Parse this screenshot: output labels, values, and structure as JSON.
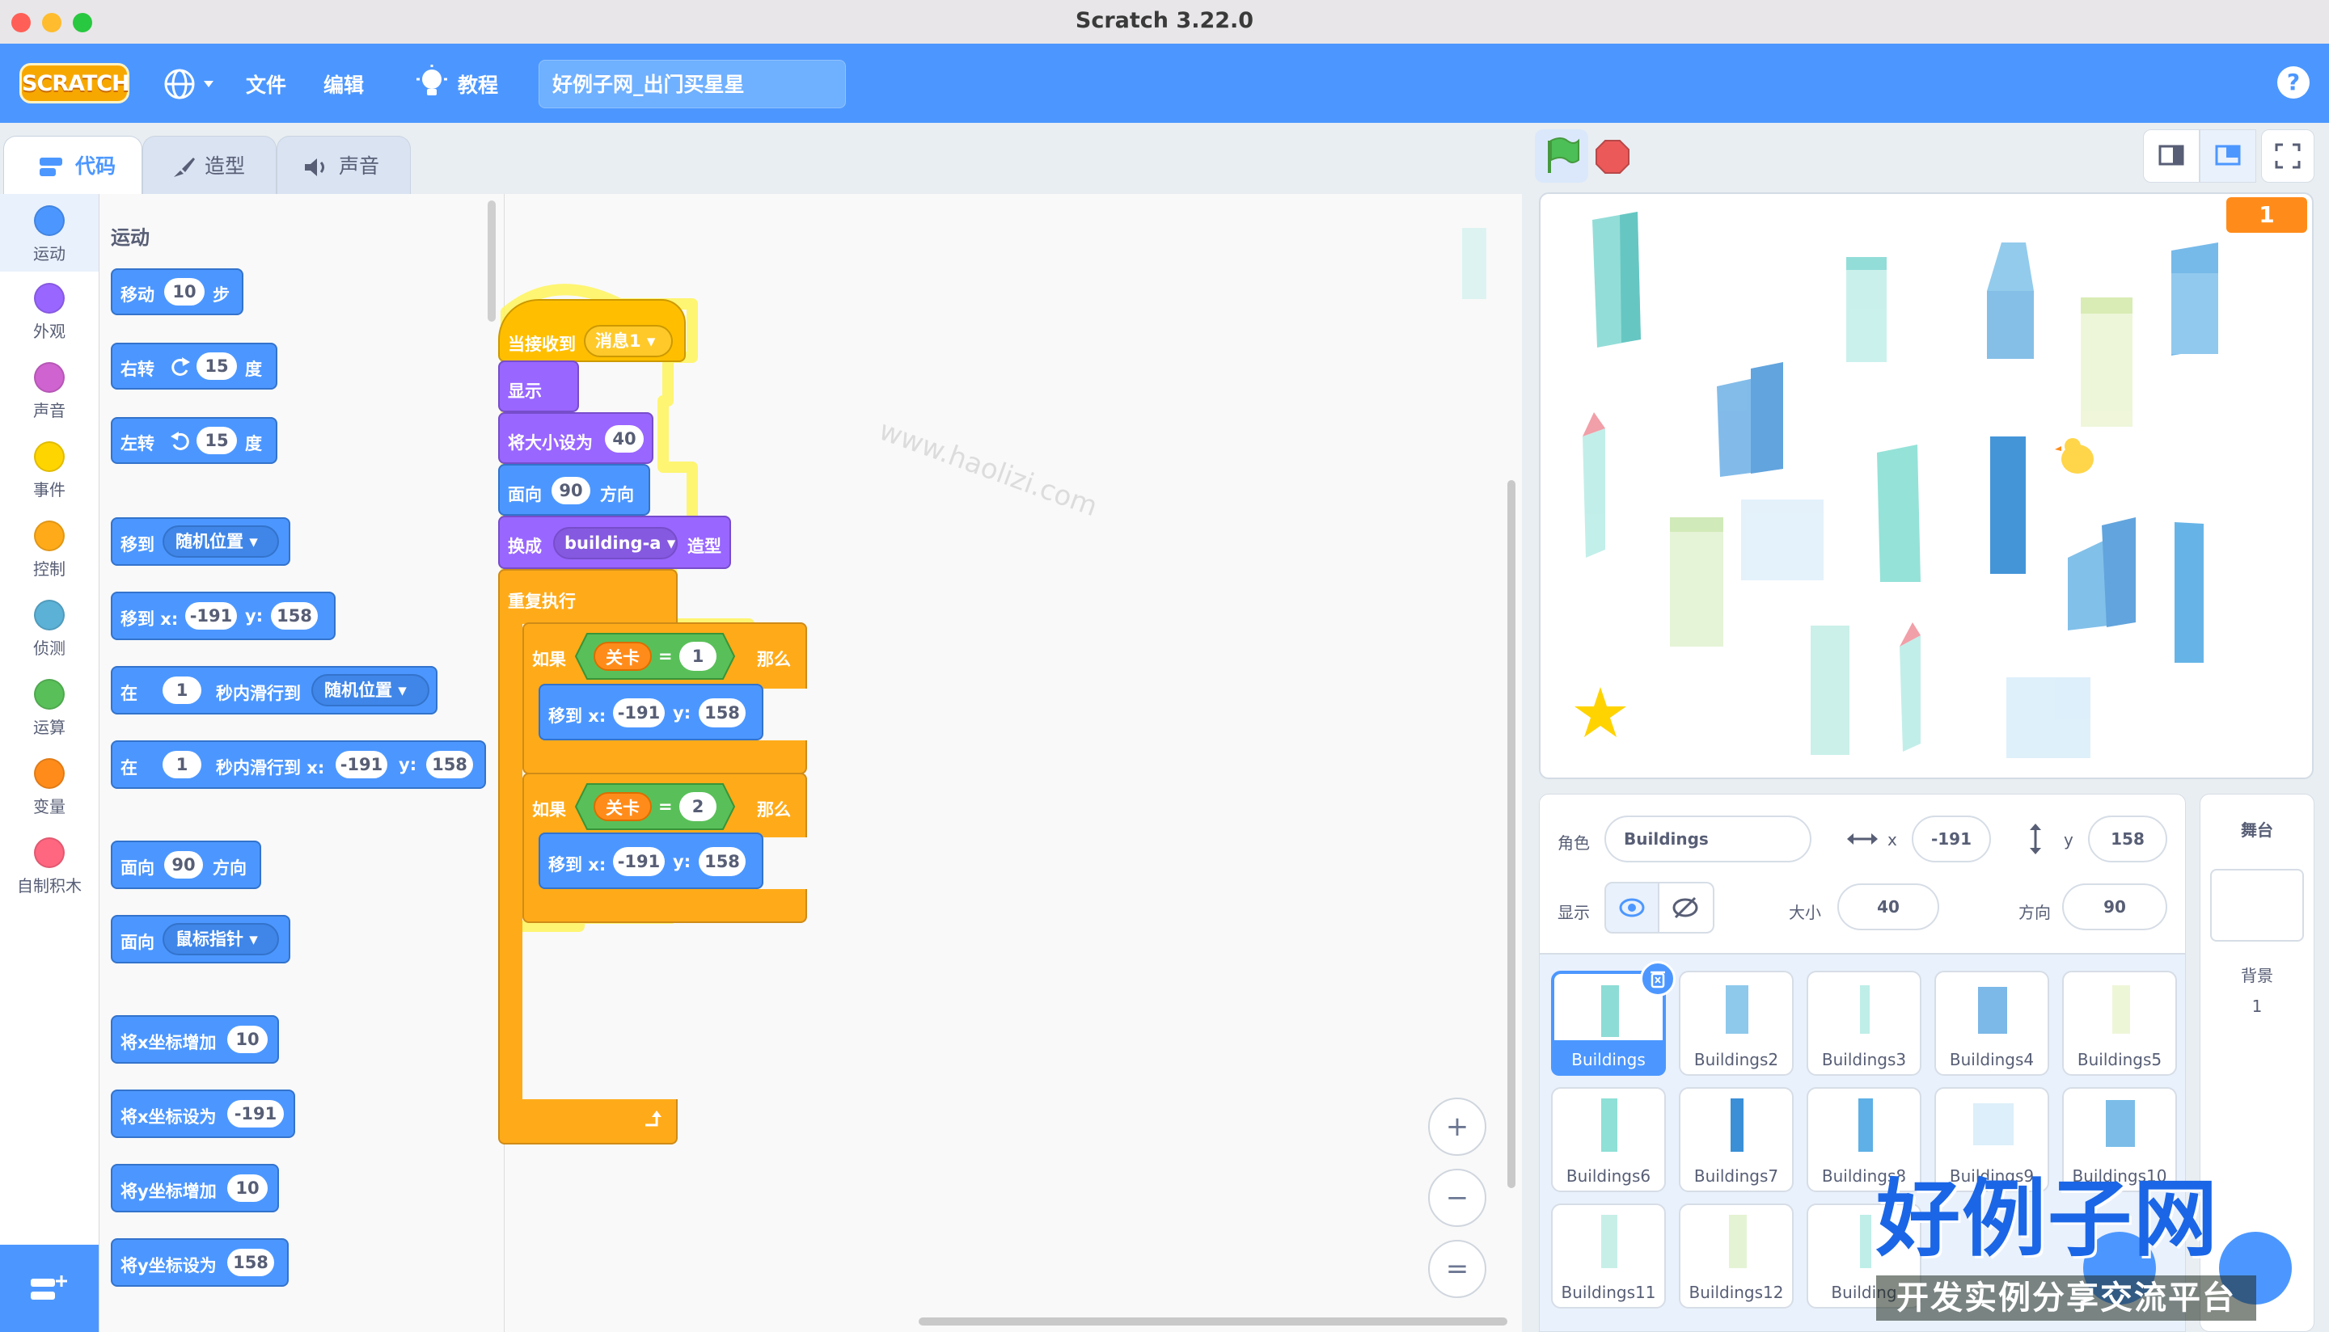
{
  "window": {
    "title": "Scratch 3.22.0"
  },
  "menubar": {
    "logo": "SCRATCH",
    "file": "文件",
    "edit": "编辑",
    "tutorials": "教程",
    "project_title": "好例子网_出门买星星",
    "help": "?"
  },
  "tabs": {
    "code": "代码",
    "costumes": "造型",
    "sounds": "声音"
  },
  "categories": [
    {
      "label": "运动",
      "color": "#4c97ff"
    },
    {
      "label": "外观",
      "color": "#9966ff"
    },
    {
      "label": "声音",
      "color": "#cf63cf"
    },
    {
      "label": "事件",
      "color": "#ffd500"
    },
    {
      "label": "控制",
      "color": "#ffab19"
    },
    {
      "label": "侦测",
      "color": "#5cb1d6"
    },
    {
      "label": "运算",
      "color": "#59c059"
    },
    {
      "label": "变量",
      "color": "#ff8c1a"
    },
    {
      "label": "自制积木",
      "color": "#ff6680"
    }
  ],
  "palette": {
    "heading": "运动",
    "move": {
      "a": "移动",
      "v": "10",
      "b": "步"
    },
    "turn_right": {
      "a": "右转",
      "v": "15",
      "b": "度"
    },
    "turn_left": {
      "a": "左转",
      "v": "15",
      "b": "度"
    },
    "goto": {
      "a": "移到",
      "dd": "随机位置"
    },
    "goto_xy": {
      "a": "移到 x:",
      "x": "-191",
      "yl": "y:",
      "y": "158"
    },
    "glide": {
      "a": "在",
      "v": "1",
      "b": "秒内滑行到",
      "dd": "随机位置"
    },
    "glide_xy": {
      "a": "在",
      "v": "1",
      "b": "秒内滑行到 x:",
      "x": "-191",
      "yl": "y:",
      "y": "158"
    },
    "point": {
      "a": "面向",
      "v": "90",
      "b": "方向"
    },
    "point_towards": {
      "a": "面向",
      "dd": "鼠标指针"
    },
    "change_x": {
      "a": "将x坐标增加",
      "v": "10"
    },
    "set_x": {
      "a": "将x坐标设为",
      "v": "-191"
    },
    "change_y": {
      "a": "将y坐标增加",
      "v": "10"
    },
    "set_y": {
      "a": "将y坐标设为",
      "v": "158"
    }
  },
  "script": {
    "hat": {
      "a": "当接收到",
      "dd": "消息1"
    },
    "show": "显示",
    "size": {
      "a": "将大小设为",
      "v": "40"
    },
    "point": {
      "a": "面向",
      "v": "90",
      "b": "方向"
    },
    "costume": {
      "a": "换成",
      "dd": "building-a",
      "b": "造型"
    },
    "forever": "重复执行",
    "if1": {
      "a": "如果",
      "var": "关卡",
      "op": "=",
      "v": "1",
      "b": "那么"
    },
    "goto1": {
      "a": "移到 x:",
      "x": "-191",
      "yl": "y:",
      "y": "158"
    },
    "if2": {
      "a": "如果",
      "var": "关卡",
      "op": "=",
      "v": "2",
      "b": "那么"
    },
    "goto2": {
      "a": "移到 x:",
      "x": "-191",
      "yl": "y:",
      "y": "158"
    }
  },
  "zoom": {
    "in": "+",
    "out": "−",
    "reset": "="
  },
  "stage": {
    "counter": "1"
  },
  "sprite_info": {
    "sprite_label": "角色",
    "sprite_name": "Buildings",
    "x_label": "x",
    "x": "-191",
    "y_label": "y",
    "y": "158",
    "show_label": "显示",
    "size_label": "大小",
    "size": "40",
    "direction_label": "方向",
    "direction": "90"
  },
  "sprites": [
    "Buildings",
    "Buildings2",
    "Buildings3",
    "Buildings4",
    "Buildings5",
    "Buildings6",
    "Buildings7",
    "Buildings8",
    "Buildings9",
    "Buildings10",
    "Buildings11",
    "Buildings12",
    "Building"
  ],
  "stage_panel": {
    "title": "舞台",
    "backdrop_label": "背景",
    "backdrop_count": "1"
  },
  "watermark": {
    "big": "好例子网",
    "small": "开发实例分享交流平台",
    "url": "www.haolizi.com"
  }
}
